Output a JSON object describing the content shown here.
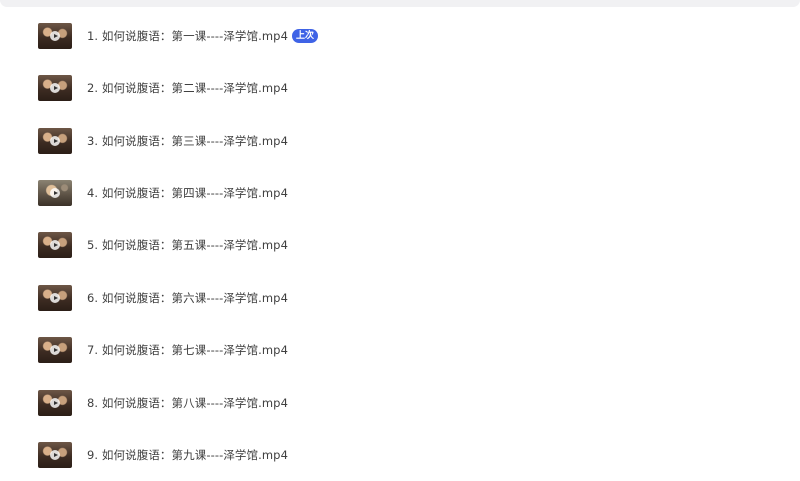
{
  "items": [
    {
      "title": "1. 如何说腹语：第一课----泽学馆.mp4",
      "badge": "上次"
    },
    {
      "title": "2. 如何说腹语：第二课----泽学馆.mp4"
    },
    {
      "title": "3. 如何说腹语：第三课----泽学馆.mp4"
    },
    {
      "title": "4. 如何说腹语：第四课----泽学馆.mp4"
    },
    {
      "title": "5. 如何说腹语：第五课----泽学馆.mp4"
    },
    {
      "title": "6. 如何说腹语：第六课----泽学馆.mp4"
    },
    {
      "title": "7. 如何说腹语：第七课----泽学馆.mp4"
    },
    {
      "title": "8. 如何说腹语：第八课----泽学馆.mp4"
    },
    {
      "title": "9. 如何说腹语：第九课----泽学馆.mp4"
    }
  ],
  "colors": {
    "badge": "#3f63e6",
    "text": "#404040"
  },
  "icons": {
    "thumbnail": "video-thumbnail-icon",
    "play": "play-icon"
  }
}
